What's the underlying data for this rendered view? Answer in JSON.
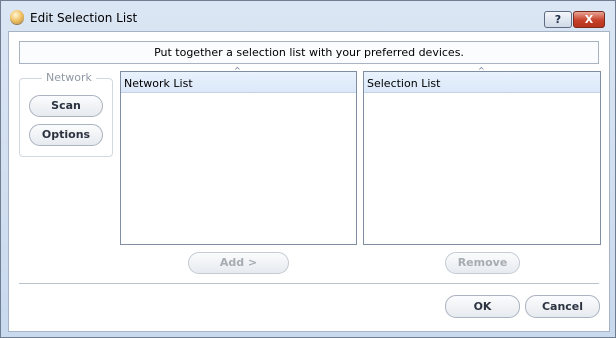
{
  "window": {
    "title": "Edit Selection List",
    "help_label": "?",
    "close_label": "X",
    "icon": "app-icon"
  },
  "banner": {
    "text": "Put together a selection list with your preferred devices."
  },
  "network_group": {
    "label": "Network",
    "scan_label": "Scan",
    "options_label": "Options"
  },
  "lists": {
    "network": {
      "header": "Network List",
      "items": []
    },
    "selection": {
      "header": "Selection List",
      "items": []
    },
    "sort_indicator": "^"
  },
  "buttons": {
    "add_label": "Add >",
    "remove_label": "Remove",
    "ok_label": "OK",
    "cancel_label": "Cancel"
  },
  "colors": {
    "accent": "#3f6ea8",
    "close_red": "#c6412a",
    "disabled_text": "#a7acb3"
  }
}
